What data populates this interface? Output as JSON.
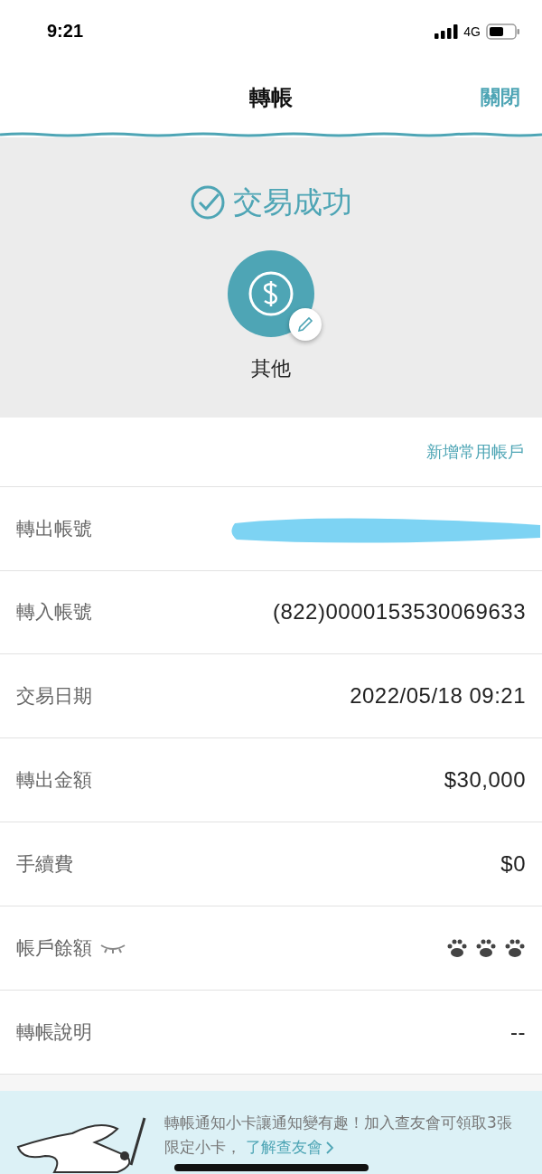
{
  "status_bar": {
    "time": "9:21",
    "network": "4G"
  },
  "nav": {
    "title": "轉帳",
    "close": "關閉"
  },
  "result": {
    "status": "交易成功",
    "category": "其他"
  },
  "add_account_link": "新增常用帳戶",
  "rows": [
    {
      "label": "轉出帳號",
      "kind": "redacted"
    },
    {
      "label": "轉入帳號",
      "kind": "text",
      "value": "(822)0000153530069633"
    },
    {
      "label": "交易日期",
      "kind": "text",
      "value": "2022/05/18 09:21"
    },
    {
      "label": "轉出金額",
      "kind": "text",
      "value": "$30,000"
    },
    {
      "label": "手續費",
      "kind": "text",
      "value": "$0"
    },
    {
      "label": "帳戶餘額",
      "kind": "masked"
    },
    {
      "label": "轉帳說明",
      "kind": "text",
      "value": "--"
    }
  ],
  "banner": {
    "text": "轉帳通知小卡讓通知變有趣！加入查友會可領取3張限定小卡，",
    "link": "了解查友會"
  }
}
